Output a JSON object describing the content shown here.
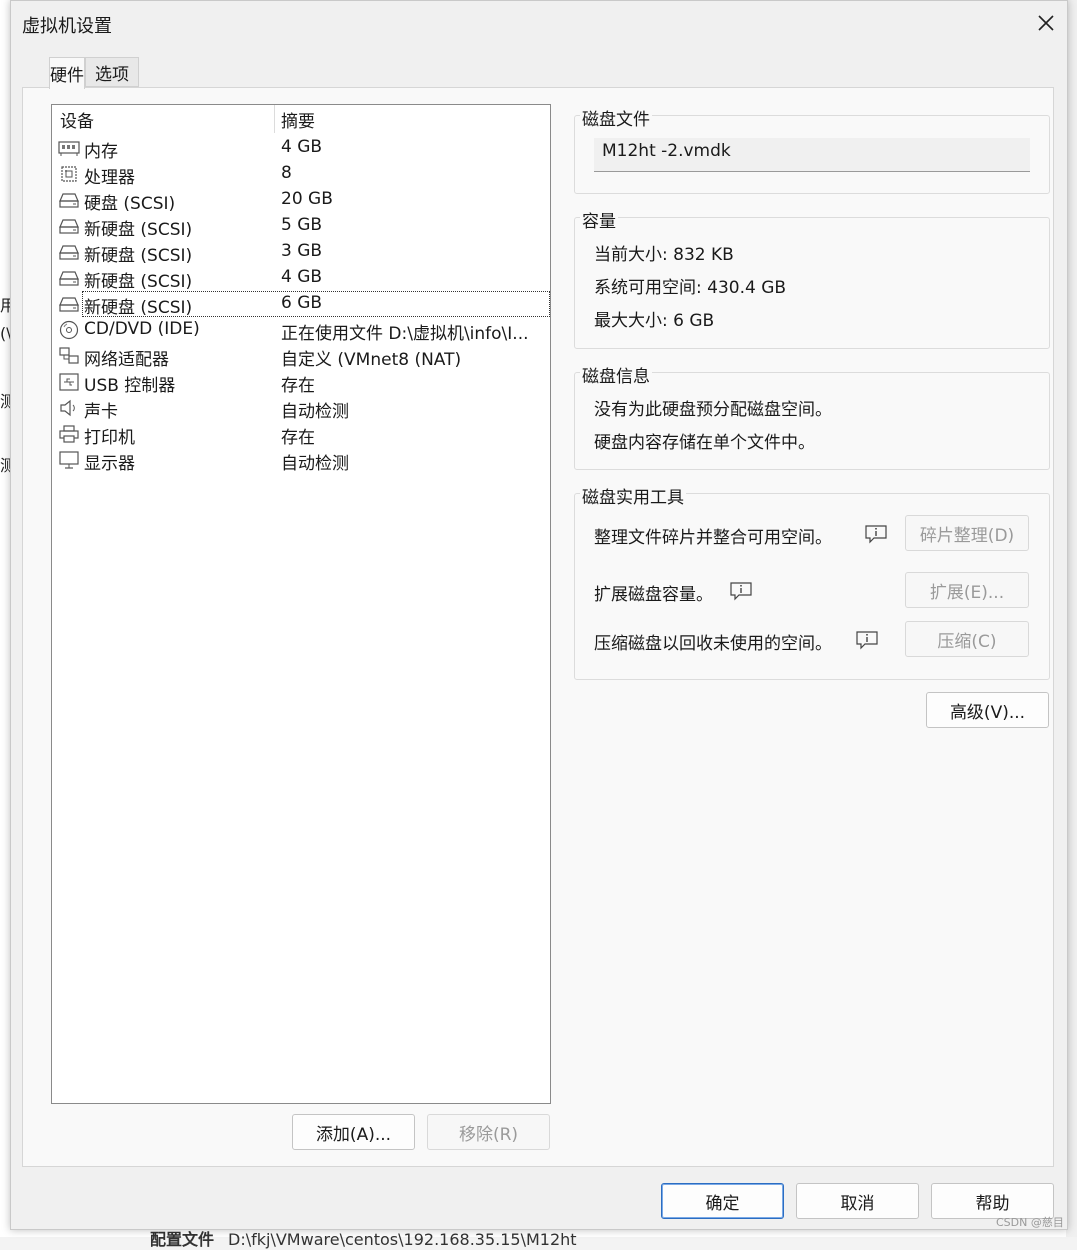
{
  "background": {
    "left_chars": [
      "用",
      "(\\",
      "测",
      "测"
    ],
    "bottom_label": "配置文件",
    "bottom_path": "D:\\fkj\\VMware\\centos\\192.168.35.15\\M12ht",
    "watermark": "CSDN @慈目"
  },
  "dialog": {
    "title": "虚拟机设置",
    "close_icon": "close-icon"
  },
  "tabs": [
    {
      "label": "硬件",
      "active": true
    },
    {
      "label": "选项",
      "active": false
    }
  ],
  "device_list": {
    "header_device": "设备",
    "header_summary": "摘要",
    "rows": [
      {
        "icon": "memory-icon",
        "name": "内存",
        "summary": "4 GB"
      },
      {
        "icon": "cpu-icon",
        "name": "处理器",
        "summary": "8"
      },
      {
        "icon": "disk-icon",
        "name": "硬盘 (SCSI)",
        "summary": "20 GB"
      },
      {
        "icon": "disk-icon",
        "name": "新硬盘 (SCSI)",
        "summary": "5 GB"
      },
      {
        "icon": "disk-icon",
        "name": "新硬盘 (SCSI)",
        "summary": "3 GB"
      },
      {
        "icon": "disk-icon",
        "name": "新硬盘 (SCSI)",
        "summary": "4 GB"
      },
      {
        "icon": "disk-icon",
        "name": "新硬盘 (SCSI)",
        "summary": "6 GB",
        "selected": true
      },
      {
        "icon": "cd-icon",
        "name": "CD/DVD (IDE)",
        "summary": "正在使用文件 D:\\虚拟机\\info\\I..."
      },
      {
        "icon": "network-icon",
        "name": "网络适配器",
        "summary": "自定义 (VMnet8 (NAT)"
      },
      {
        "icon": "usb-icon",
        "name": "USB 控制器",
        "summary": "存在"
      },
      {
        "icon": "sound-icon",
        "name": "声卡",
        "summary": "自动检测"
      },
      {
        "icon": "printer-icon",
        "name": "打印机",
        "summary": "存在"
      },
      {
        "icon": "monitor-icon",
        "name": "显示器",
        "summary": "自动检测"
      }
    ],
    "add_label": "添加(A)...",
    "remove_label": "移除(R)"
  },
  "disk_file": {
    "label": "磁盘文件",
    "value": "M12ht -2.vmdk"
  },
  "capacity": {
    "label": "容量",
    "current": "当前大小: 832 KB",
    "available": "系统可用空间: 430.4 GB",
    "max": "最大大小: 6 GB"
  },
  "disk_info": {
    "label": "磁盘信息",
    "line1": "没有为此硬盘预分配磁盘空间。",
    "line2": "硬盘内容存储在单个文件中。"
  },
  "disk_tools": {
    "label": "磁盘实用工具",
    "defrag_text": "整理文件碎片并整合可用空间。",
    "defrag_button": "碎片整理(D)",
    "expand_text": "扩展磁盘容量。",
    "expand_button": "扩展(E)...",
    "compact_text": "压缩磁盘以回收未使用的空间。",
    "compact_button": "压缩(C)"
  },
  "advanced_button": "高级(V)...",
  "footer": {
    "ok": "确定",
    "cancel": "取消",
    "help": "帮助"
  },
  "colors": {
    "primary_border": "#2b6dc2",
    "disabled_text": "#9a9a9a"
  }
}
